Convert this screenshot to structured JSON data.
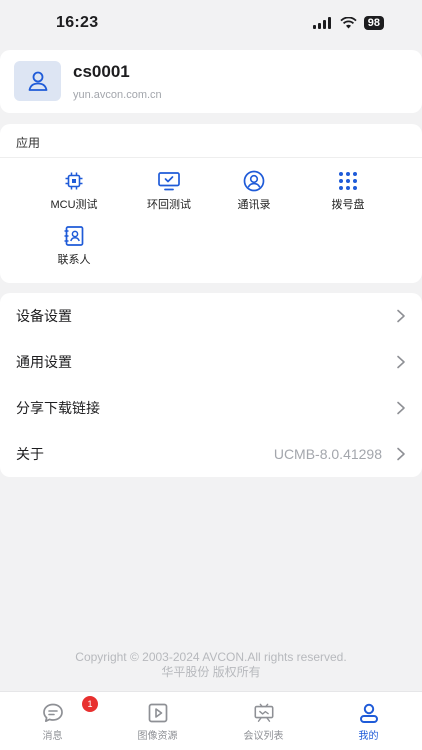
{
  "status_bar": {
    "time": "16:23",
    "battery": "98"
  },
  "profile": {
    "name": "cs0001",
    "domain": "yun.avcon.com.cn"
  },
  "apps": {
    "title": "应用",
    "items": [
      {
        "label": "MCU测试",
        "icon": "chip-icon"
      },
      {
        "label": "环回测试",
        "icon": "monitor-check-icon"
      },
      {
        "label": "通讯录",
        "icon": "contact-circle-icon"
      },
      {
        "label": "拨号盘",
        "icon": "dialpad-icon"
      },
      {
        "label": "联系人",
        "icon": "contact-book-icon"
      }
    ]
  },
  "settings": [
    {
      "label": "设备设置",
      "value": ""
    },
    {
      "label": "通用设置",
      "value": ""
    },
    {
      "label": "分享下载链接",
      "value": ""
    },
    {
      "label": "关于",
      "value": "UCMB-8.0.41298"
    }
  ],
  "footer": {
    "copyright": "Copyright © 2003-2024 AVCON.All rights reserved.",
    "rights": "华平股份 版权所有"
  },
  "tabs": [
    {
      "label": "消息",
      "icon": "message-icon",
      "badge": "1",
      "active": false
    },
    {
      "label": "图像资源",
      "icon": "video-icon",
      "badge": "",
      "active": false
    },
    {
      "label": "会议列表",
      "icon": "meeting-icon",
      "badge": "",
      "active": false
    },
    {
      "label": "我的",
      "icon": "person-icon",
      "badge": "",
      "active": true
    }
  ],
  "colors": {
    "accent": "#1f5bd8",
    "badge": "#e8302f",
    "background": "#f2f2f3"
  }
}
